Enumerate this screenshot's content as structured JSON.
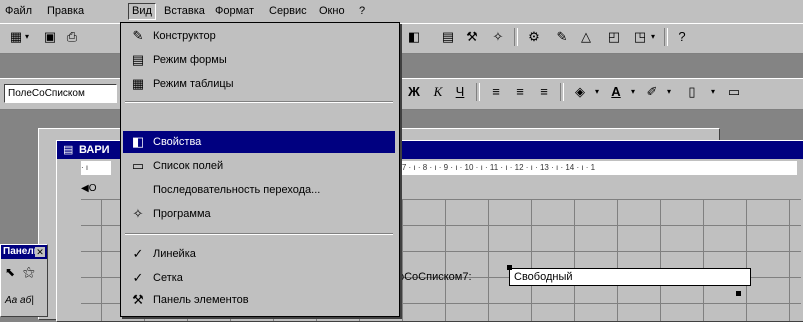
{
  "menubar": {
    "items": [
      {
        "label": "Файл"
      },
      {
        "label": "Правка"
      },
      {
        "label": "Вид"
      },
      {
        "label": "Вставка"
      },
      {
        "label": "Формат"
      },
      {
        "label": "Сервис"
      },
      {
        "label": "Окно"
      },
      {
        "label": "?"
      }
    ]
  },
  "toolbar2": {
    "combo_value": "ПолеСоСписком",
    "font_buttons": [
      "Ж",
      "К",
      "Ч"
    ]
  },
  "form_window": {
    "title": "ВАРИ",
    "ruler_text": "· 7 · ı · 8 · ı · 9 · ı · 10 · ı · 11 · ı · 12 · ı · 13 · ı · 14 · ı · 1",
    "ruler_left": "· ı",
    "section_label": "О"
  },
  "toolbox_panel": {
    "title": "Панель",
    "row_label": "Аа  аб|"
  },
  "controls": {
    "field_label": "оСоСписком7:",
    "field_value": "Свободный"
  },
  "dropdown": {
    "items": [
      {
        "label": "Конструктор",
        "icon": "design-view-icon"
      },
      {
        "label": "Режим формы",
        "icon": "form-view-icon"
      },
      {
        "label": "Режим таблицы",
        "icon": "datasheet-view-icon"
      },
      {
        "label": "Свойства",
        "icon": "properties-icon",
        "active": true
      },
      {
        "label": "Список полей",
        "icon": "field-list-icon"
      },
      {
        "label": "Последовательность перехода...",
        "icon": ""
      },
      {
        "label": "Программа",
        "icon": "code-icon"
      },
      {
        "label": "Линейка",
        "icon": "check-icon"
      },
      {
        "label": "Сетка",
        "icon": "check-icon"
      },
      {
        "label": "Панель элементов",
        "icon": "toolbox-icon"
      }
    ]
  },
  "colors": {
    "title_bar": "#000080",
    "menu_bg": "#c0c0c0",
    "workspace": "#848484"
  }
}
